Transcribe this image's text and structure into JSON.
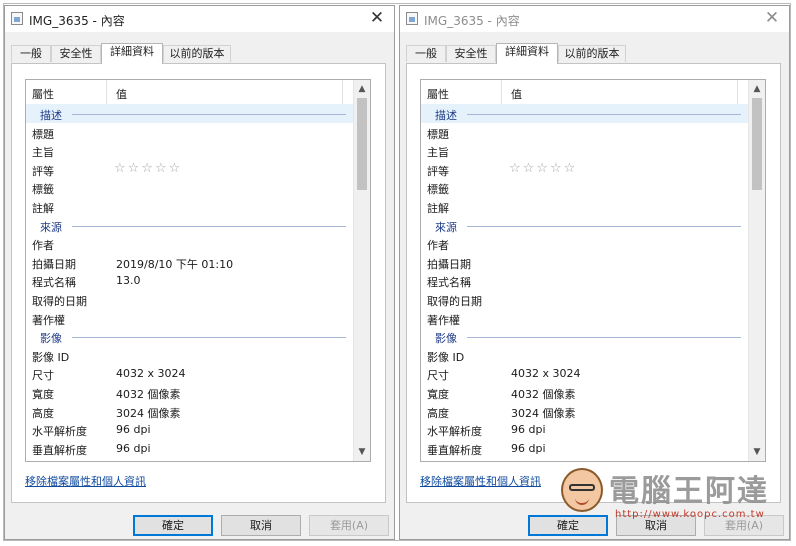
{
  "windows": [
    {
      "title": "IMG_3635 - 內容",
      "close_glyph": "✕",
      "tabs": [
        "一般",
        "安全性",
        "詳細資料",
        "以前的版本"
      ],
      "active_tab": 2,
      "header": {
        "property": "屬性",
        "value": "值"
      },
      "rows": [
        {
          "type": "group",
          "label": "描述"
        },
        {
          "type": "item",
          "prop": "標題",
          "val": ""
        },
        {
          "type": "item",
          "prop": "主旨",
          "val": ""
        },
        {
          "type": "rating",
          "prop": "評等",
          "val": "☆☆☆☆☆"
        },
        {
          "type": "item",
          "prop": "標籤",
          "val": ""
        },
        {
          "type": "item",
          "prop": "註解",
          "val": ""
        },
        {
          "type": "group",
          "label": "來源"
        },
        {
          "type": "item",
          "prop": "作者",
          "val": ""
        },
        {
          "type": "item",
          "prop": "拍攝日期",
          "val": "2019/8/10 下午 01:10"
        },
        {
          "type": "item",
          "prop": "程式名稱",
          "val": "13.0"
        },
        {
          "type": "item",
          "prop": "取得的日期",
          "val": ""
        },
        {
          "type": "item",
          "prop": "著作權",
          "val": ""
        },
        {
          "type": "group",
          "label": "影像"
        },
        {
          "type": "item",
          "prop": "影像 ID",
          "val": ""
        },
        {
          "type": "item",
          "prop": "尺寸",
          "val": "4032 x 3024"
        },
        {
          "type": "item",
          "prop": "寬度",
          "val": "4032 個像素"
        },
        {
          "type": "item",
          "prop": "高度",
          "val": "3024 個像素"
        },
        {
          "type": "item",
          "prop": "水平解析度",
          "val": "96 dpi"
        },
        {
          "type": "item",
          "prop": "垂直解析度",
          "val": "96 dpi"
        }
      ],
      "remove_link": "移除檔案屬性和個人資訊",
      "buttons": {
        "ok": "確定",
        "cancel": "取消",
        "apply": "套用(A)"
      }
    },
    {
      "title": "IMG_3635 - 內容",
      "close_glyph": "✕",
      "tabs": [
        "一般",
        "安全性",
        "詳細資料",
        "以前的版本"
      ],
      "active_tab": 2,
      "header": {
        "property": "屬性",
        "value": "值"
      },
      "rows": [
        {
          "type": "group",
          "label": "描述"
        },
        {
          "type": "item",
          "prop": "標題",
          "val": ""
        },
        {
          "type": "item",
          "prop": "主旨",
          "val": ""
        },
        {
          "type": "rating",
          "prop": "評等",
          "val": "☆☆☆☆☆"
        },
        {
          "type": "item",
          "prop": "標籤",
          "val": ""
        },
        {
          "type": "item",
          "prop": "註解",
          "val": ""
        },
        {
          "type": "group",
          "label": "來源"
        },
        {
          "type": "item",
          "prop": "作者",
          "val": ""
        },
        {
          "type": "item",
          "prop": "拍攝日期",
          "val": ""
        },
        {
          "type": "item",
          "prop": "程式名稱",
          "val": ""
        },
        {
          "type": "item",
          "prop": "取得的日期",
          "val": ""
        },
        {
          "type": "item",
          "prop": "著作權",
          "val": ""
        },
        {
          "type": "group",
          "label": "影像"
        },
        {
          "type": "item",
          "prop": "影像 ID",
          "val": ""
        },
        {
          "type": "item",
          "prop": "尺寸",
          "val": "4032 x 3024"
        },
        {
          "type": "item",
          "prop": "寬度",
          "val": "4032 個像素"
        },
        {
          "type": "item",
          "prop": "高度",
          "val": "3024 個像素"
        },
        {
          "type": "item",
          "prop": "水平解析度",
          "val": "96 dpi"
        },
        {
          "type": "item",
          "prop": "垂直解析度",
          "val": "96 dpi"
        }
      ],
      "remove_link": "移除檔案屬性和個人資訊",
      "buttons": {
        "ok": "確定",
        "cancel": "取消",
        "apply": "套用(A)"
      }
    }
  ],
  "scroll_arrows": {
    "up": "▲",
    "down": "▼"
  },
  "watermark": {
    "name": "電腦王阿達",
    "url": "http://www.koopc.com.tw"
  },
  "colors": {
    "accent": "#0078d7",
    "group_label": "#1f3c88",
    "link": "#0f4a9e",
    "selected_row": "#e5f1fb"
  }
}
